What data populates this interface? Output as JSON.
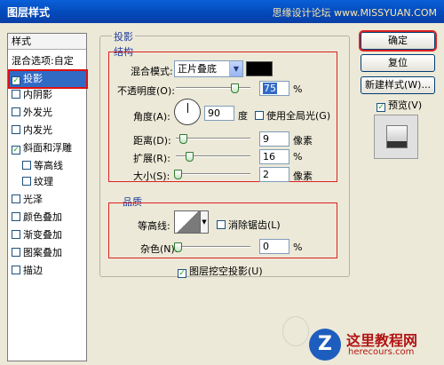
{
  "window": {
    "title": "图层样式",
    "watermark": "思缘设计论坛 www.MISSYUAN.COM"
  },
  "styles_panel": {
    "header": "样式",
    "blend_options": "混合选项:自定",
    "items": [
      {
        "label": "投影",
        "checked": true,
        "selected": true
      },
      {
        "label": "内阴影",
        "checked": false
      },
      {
        "label": "外发光",
        "checked": false
      },
      {
        "label": "内发光",
        "checked": false
      },
      {
        "label": "斜面和浮雕",
        "checked": true
      },
      {
        "label": "等高线",
        "checked": false
      },
      {
        "label": "纹理",
        "checked": false
      },
      {
        "label": "光泽",
        "checked": false
      },
      {
        "label": "颜色叠加",
        "checked": false
      },
      {
        "label": "渐变叠加",
        "checked": false
      },
      {
        "label": "图案叠加",
        "checked": false
      },
      {
        "label": "描边",
        "checked": false
      }
    ]
  },
  "drop_shadow": {
    "title": "投影",
    "structure": {
      "title": "结构",
      "blend_mode_label": "混合模式:",
      "blend_mode_value": "正片叠底",
      "opacity_label": "不透明度(O):",
      "opacity_value": "75",
      "opacity_unit": "%",
      "angle_label": "角度(A):",
      "angle_value": "90",
      "angle_unit": "度",
      "global_light_label": "使用全局光(G)",
      "distance_label": "距离(D):",
      "distance_value": "9",
      "distance_unit": "像素",
      "spread_label": "扩展(R):",
      "spread_value": "16",
      "spread_unit": "%",
      "size_label": "大小(S):",
      "size_value": "2",
      "size_unit": "像素"
    },
    "quality": {
      "title": "品质",
      "contour_label": "等高线:",
      "antialias_label": "消除锯齿(L)",
      "noise_label": "杂色(N):",
      "noise_value": "0",
      "noise_unit": "%"
    },
    "knockout_label": "图层挖空投影(U)"
  },
  "buttons": {
    "ok": "确定",
    "reset": "复位",
    "new_style": "新建样式(W)...",
    "preview_label": "预览(V)"
  },
  "logo": {
    "cn": "这里教程网",
    "en": "herecours.com",
    "mark": "Z"
  },
  "colors": {
    "shadow_color": "#000000",
    "accent": "#316ac5",
    "highlight_border": "#d22222"
  }
}
